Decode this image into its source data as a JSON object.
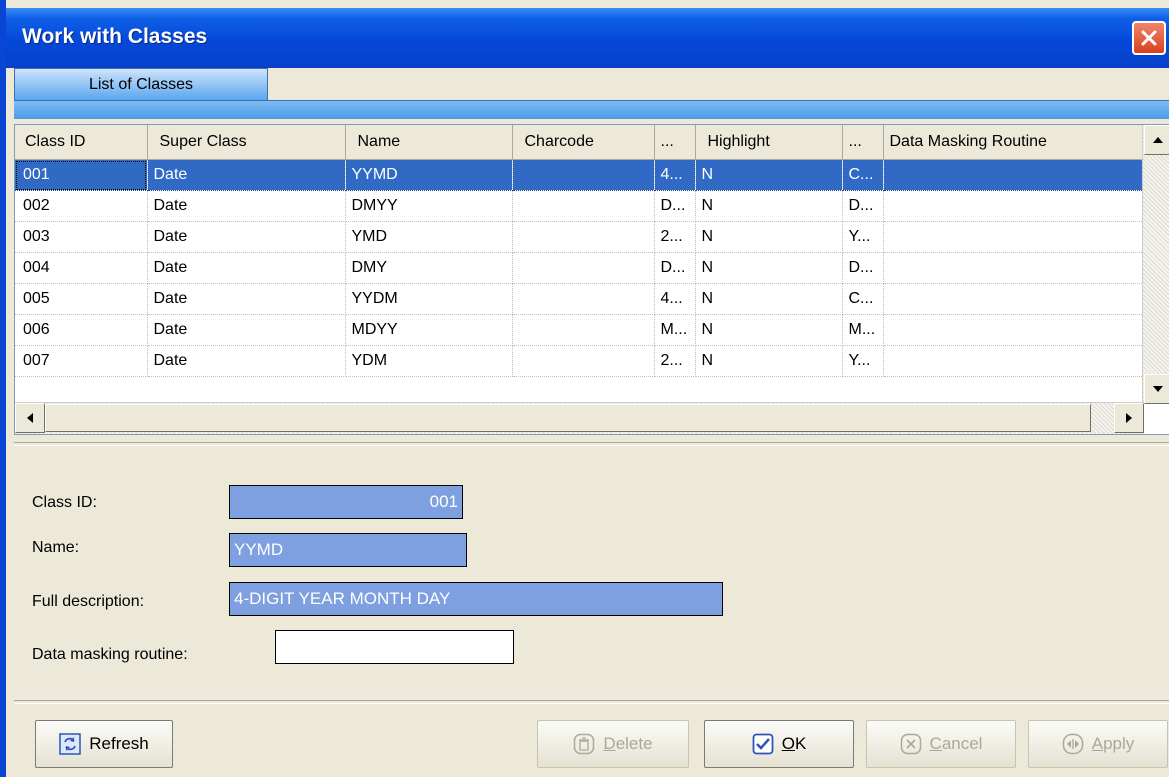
{
  "window": {
    "title": "Work with Classes"
  },
  "tabs": [
    {
      "label": "List of Classes"
    }
  ],
  "grid": {
    "columns": [
      "Class ID",
      "Super Class",
      "Name",
      "Charcode",
      "...",
      "Highlight",
      "...",
      "Data Masking Routine"
    ],
    "rows": [
      {
        "id": "001",
        "super": "Date",
        "name": "YYMD",
        "charcode": "",
        "c5": "4...",
        "highlight": "N",
        "c7": "C...",
        "mask": ""
      },
      {
        "id": "002",
        "super": "Date",
        "name": "DMYY",
        "charcode": "",
        "c5": "D...",
        "highlight": "N",
        "c7": "D...",
        "mask": ""
      },
      {
        "id": "003",
        "super": "Date",
        "name": "YMD",
        "charcode": "",
        "c5": "2...",
        "highlight": "N",
        "c7": "Y...",
        "mask": ""
      },
      {
        "id": "004",
        "super": "Date",
        "name": "DMY",
        "charcode": "",
        "c5": "D...",
        "highlight": "N",
        "c7": "D...",
        "mask": ""
      },
      {
        "id": "005",
        "super": "Date",
        "name": "YYDM",
        "charcode": "",
        "c5": "4...",
        "highlight": "N",
        "c7": "C...",
        "mask": ""
      },
      {
        "id": "006",
        "super": "Date",
        "name": "MDYY",
        "charcode": "",
        "c5": "M...",
        "highlight": "N",
        "c7": "M...",
        "mask": ""
      },
      {
        "id": "007",
        "super": "Date",
        "name": "YDM",
        "charcode": "",
        "c5": "2...",
        "highlight": "N",
        "c7": "Y...",
        "mask": ""
      }
    ]
  },
  "form": {
    "class_id_label": "Class ID:",
    "class_id_value": "001",
    "name_label": "Name:",
    "name_value": "YYMD",
    "desc_label": "Full description:",
    "desc_value": "4-DIGIT YEAR MONTH DAY",
    "mask_label": "Data masking routine:",
    "mask_value": ""
  },
  "buttons": {
    "refresh": "Refresh",
    "delete_pre": "",
    "delete_u": "D",
    "delete_post": "elete",
    "ok_pre": "",
    "ok_u": "O",
    "ok_post": "K",
    "cancel_pre": "",
    "cancel_u": "C",
    "cancel_post": "ancel",
    "apply_pre": "",
    "apply_u": "A",
    "apply_post": "pply"
  },
  "colors": {
    "selection": "#316ac5",
    "field_highlight": "#7e9fe0",
    "titlebar": "#0548d8"
  }
}
